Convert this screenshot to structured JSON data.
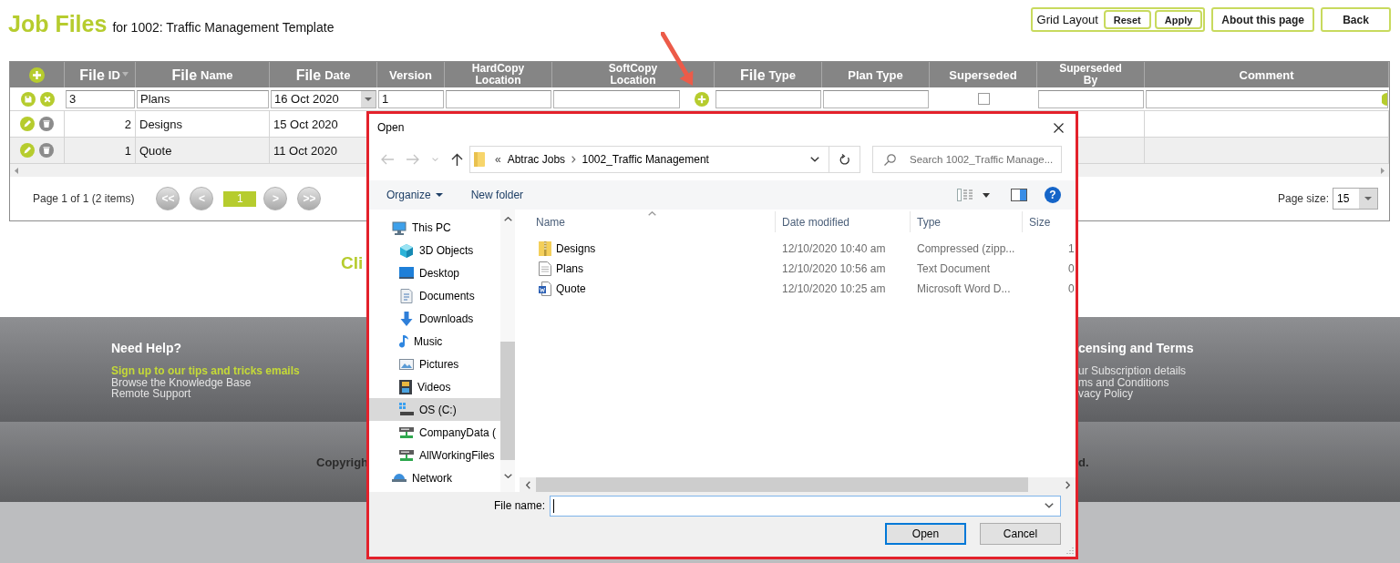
{
  "header": {
    "title": "Job Files",
    "subtitle": "for 1002: Traffic Management Template"
  },
  "actions": {
    "grid_layout": {
      "label": "Grid Layout",
      "buttons": [
        "Reset",
        "Apply"
      ]
    },
    "buttons": [
      "About this page",
      "Back"
    ]
  },
  "grid": {
    "columns": [
      {
        "kind": "action"
      },
      {
        "kind": "split",
        "prefix": "File",
        "label": "ID",
        "sorted": true
      },
      {
        "kind": "split",
        "prefix": "File",
        "label": "Name",
        "sorted": false
      },
      {
        "kind": "split",
        "prefix": "File",
        "label": "Date",
        "sorted": false
      },
      {
        "kind": "plain",
        "label": "Version",
        "sorted": false
      },
      {
        "kind": "stacked",
        "label": "HardCopy Location",
        "sorted": false
      },
      {
        "kind": "stacked",
        "label": "SoftCopy Location",
        "sorted": false
      },
      {
        "kind": "split",
        "prefix": "File",
        "label": "Type",
        "sorted": false
      },
      {
        "kind": "plain",
        "label": "Plan Type",
        "sorted": false
      },
      {
        "kind": "plain",
        "label": "Superseded",
        "sorted": false
      },
      {
        "kind": "stacked",
        "label": "Superseded By",
        "sorted": false
      },
      {
        "kind": "plain",
        "label": "Comment",
        "sorted": false
      }
    ],
    "edit_row": {
      "cells": [
        {
          "kind": "input",
          "value": "3"
        },
        {
          "kind": "input",
          "value": "Plans"
        },
        {
          "kind": "date",
          "value": "16 Oct 2020"
        },
        {
          "kind": "input",
          "value": "1"
        },
        {
          "kind": "input"
        },
        {
          "kind": "upload"
        },
        {
          "kind": "input"
        },
        {
          "kind": "input"
        },
        {
          "kind": "checkbox",
          "checked": false
        },
        {
          "kind": "input"
        },
        {
          "kind": "addon"
        }
      ]
    },
    "rows": [
      {
        "file_id": "2",
        "file_name": "Designs",
        "file_date": "15 Oct 2020"
      },
      {
        "file_id": "1",
        "file_name": "Quote",
        "file_date": "11 Oct 2020"
      }
    ],
    "pager": {
      "summary": "Page 1 of 1 (2 items)",
      "first": "<<",
      "previous": "<",
      "pages": [
        {
          "label": "1",
          "selected": true
        }
      ],
      "next": ">",
      "last": ">>",
      "page_size_label": "Page size:",
      "page_size": "15"
    }
  },
  "hint": "Cli",
  "dialog": {
    "title": "Open",
    "address": {
      "overflow": "«",
      "crumbs": [
        "Abtrac Jobs",
        "1002_Traffic Management"
      ]
    },
    "search": {
      "placeholder": "Search 1002_Traffic Manage..."
    },
    "toolbar": {
      "organize": "Organize",
      "new_folder": "New folder",
      "help": "?"
    },
    "nav": [
      {
        "label": "This PC",
        "kind": "pc",
        "selected": false,
        "children": [
          {
            "label": "3D Objects",
            "kind": "objects",
            "selected": false
          },
          {
            "label": "Desktop",
            "kind": "desktop",
            "selected": false
          },
          {
            "label": "Documents",
            "kind": "documents",
            "selected": false
          },
          {
            "label": "Downloads",
            "kind": "downloads",
            "selected": false
          },
          {
            "label": "Music",
            "kind": "music",
            "selected": false
          },
          {
            "label": "Pictures",
            "kind": "pictures",
            "selected": false
          },
          {
            "label": "Videos",
            "kind": "videos",
            "selected": false
          },
          {
            "label": "OS (C:)",
            "kind": "drive",
            "selected": true
          },
          {
            "label": "CompanyData (",
            "kind": "netdrive",
            "selected": false
          },
          {
            "label": "AllWorkingFiles",
            "kind": "netdrive",
            "selected": false
          }
        ]
      },
      {
        "label": "Network",
        "kind": "network",
        "selected": false
      }
    ],
    "columns": [
      {
        "label": "Name",
        "sorted": true
      },
      {
        "label": "Date modified",
        "sorted": false
      },
      {
        "label": "Type",
        "sorted": false
      },
      {
        "label": "Size",
        "sorted": false
      }
    ],
    "files": [
      {
        "name": "Designs",
        "kind": "zip",
        "modified": "12/10/2020 10:40 am",
        "type": "Compressed (zipp...",
        "size": "1"
      },
      {
        "name": "Plans",
        "kind": "text",
        "modified": "12/10/2020 10:56 am",
        "type": "Text Document",
        "size": "0"
      },
      {
        "name": "Quote",
        "kind": "word",
        "modified": "12/10/2020 10:25 am",
        "type": "Microsoft Word D...",
        "size": "0"
      }
    ],
    "file_name": {
      "label": "File name:"
    },
    "buttons": [
      {
        "label": "Open",
        "default": true
      },
      {
        "label": "Cancel",
        "default": false
      }
    ]
  },
  "footer": {
    "columns": [
      {
        "heading": "Need Help?",
        "links": [
          {
            "label": "Sign up to our tips and tricks emails",
            "highlighted": true
          },
          {
            "label": "Browse the Knowledge Base",
            "highlighted": false
          },
          {
            "label": "Remote Support",
            "highlighted": false
          }
        ]
      },
      {
        "heading": "censing and Terms",
        "links": [
          {
            "label": "ur Subscription details",
            "highlighted": false
          },
          {
            "label": "ms and Conditions",
            "highlighted": false
          },
          {
            "label": "vacy Policy",
            "highlighted": false
          }
        ]
      }
    ],
    "copyright": {
      "start": "Copyrigh",
      "end": "d."
    }
  }
}
